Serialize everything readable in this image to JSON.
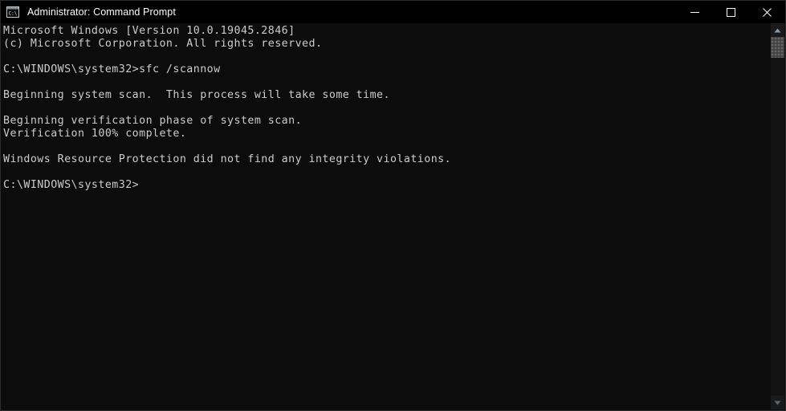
{
  "window": {
    "title": "Administrator: Command Prompt",
    "icon": "command-prompt-icon",
    "colors": {
      "titlebar_background": "#000000",
      "console_background": "#0c0c0c",
      "console_foreground": "#cccccc",
      "window_border": "#2b2b2b",
      "scrollbar_track": "#121212",
      "scrollbar_thumb": "#4d4d4d"
    }
  },
  "titlebar": {
    "minimize_label": "Minimize",
    "maximize_label": "Maximize",
    "close_label": "Close"
  },
  "console": {
    "lines": [
      "Microsoft Windows [Version 10.0.19045.2846]",
      "(c) Microsoft Corporation. All rights reserved.",
      "",
      "C:\\WINDOWS\\system32>sfc /scannow",
      "",
      "Beginning system scan.  This process will take some time.",
      "",
      "Beginning verification phase of system scan.",
      "Verification 100% complete.",
      "",
      "Windows Resource Protection did not find any integrity violations.",
      "",
      "C:\\WINDOWS\\system32>"
    ],
    "text": "Microsoft Windows [Version 10.0.19045.2846]\n(c) Microsoft Corporation. All rights reserved.\n\nC:\\WINDOWS\\system32>sfc /scannow\n\nBeginning system scan.  This process will take some time.\n\nBeginning verification phase of system scan.\nVerification 100% complete.\n\nWindows Resource Protection did not find any integrity violations.\n\nC:\\WINDOWS\\system32>",
    "command": "sfc /scannow",
    "prompt": "C:\\WINDOWS\\system32>",
    "os_version": "10.0.19045.2846",
    "verification_percent": "100%",
    "result_status": "Windows Resource Protection did not find any integrity violations."
  },
  "scrollbar": {
    "up_arrow": "scroll-up-arrow-icon",
    "down_arrow": "scroll-down-arrow-icon"
  }
}
